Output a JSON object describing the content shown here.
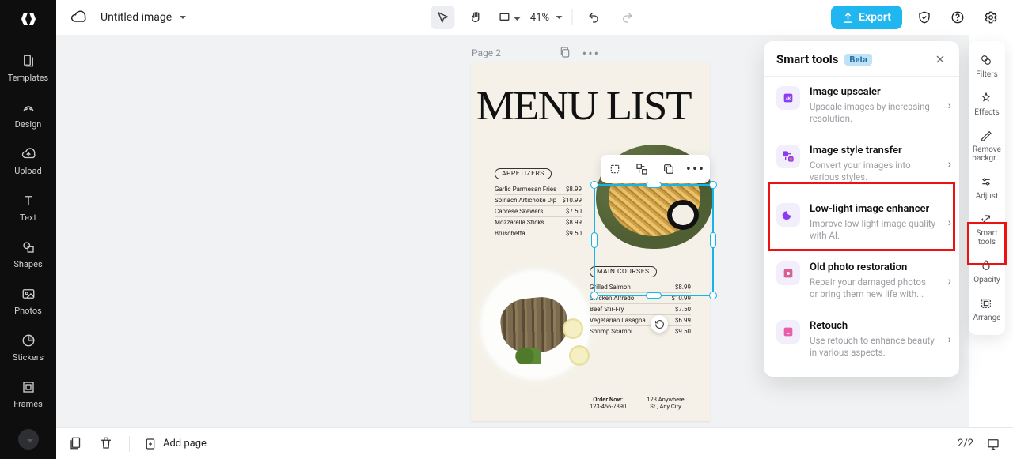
{
  "topbar": {
    "doc_title": "Untitled image",
    "zoom_percent": "41%",
    "export_label": "Export"
  },
  "left_nav": {
    "items": [
      {
        "label": "Templates"
      },
      {
        "label": "Design"
      },
      {
        "label": "Upload"
      },
      {
        "label": "Text"
      },
      {
        "label": "Shapes"
      },
      {
        "label": "Photos"
      },
      {
        "label": "Stickers"
      },
      {
        "label": "Frames"
      }
    ]
  },
  "canvas": {
    "page_label": "Page 2",
    "menu_title": "MENU LIST",
    "section_appetizers": "APPETIZERS",
    "appetizers": [
      {
        "name": "Garlic Parmesan Fries",
        "price": "$8.99"
      },
      {
        "name": "Spinach Artichoke Dip",
        "price": "$10.99"
      },
      {
        "name": "Caprese Skewers",
        "price": "$7.50"
      },
      {
        "name": "Mozzarella Sticks",
        "price": "$8.99"
      },
      {
        "name": "Bruschetta",
        "price": "$9.50"
      }
    ],
    "section_main": "MAIN COURSES",
    "mains": [
      {
        "name": "Grilled Salmon",
        "price": "$8.99"
      },
      {
        "name": "Chicken Alfredo",
        "price": "$10.99"
      },
      {
        "name": "Beef Stir-Fry",
        "price": "$7.50"
      },
      {
        "name": "Vegetarian Lasagna",
        "price": "$6.99"
      },
      {
        "name": "Shrimp Scampi",
        "price": "$9.50"
      }
    ],
    "footer": {
      "order_label": "Order Now:",
      "phone": "123-456-7890",
      "addr1": "123 Anywhere",
      "addr2": "St., Any City"
    }
  },
  "smart_tools": {
    "title": "Smart tools",
    "badge": "Beta",
    "items": [
      {
        "title": "Image upscaler",
        "desc": "Upscale images by increasing resolution."
      },
      {
        "title": "Image style transfer",
        "desc": "Convert your images into various styles."
      },
      {
        "title": "Low-light image enhancer",
        "desc": "Improve low-light image quality with AI."
      },
      {
        "title": "Old photo restoration",
        "desc": "Repair your damaged photos or bring them new life with..."
      },
      {
        "title": "Retouch",
        "desc": "Use retouch to enhance beauty in various aspects."
      }
    ]
  },
  "right_rail": {
    "items": [
      {
        "label": "Filters"
      },
      {
        "label": "Effects"
      },
      {
        "label": "Remove backgr..."
      },
      {
        "label": "Adjust"
      },
      {
        "label": "Smart tools"
      },
      {
        "label": "Opacity"
      },
      {
        "label": "Arrange"
      }
    ]
  },
  "bottombar": {
    "add_page": "Add page",
    "page_indicator": "2/2"
  }
}
